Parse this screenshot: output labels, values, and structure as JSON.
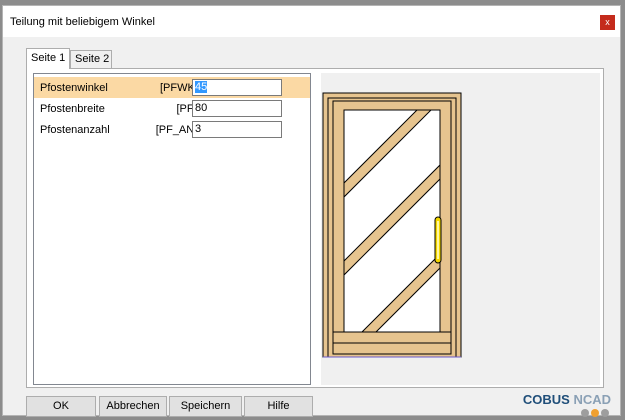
{
  "window": {
    "title": "Teilung mit beliebigem Winkel",
    "close_label": "x"
  },
  "tabs": [
    {
      "label": "Seite 1",
      "active": true
    },
    {
      "label": "Seite 2",
      "active": false
    }
  ],
  "parameters": [
    {
      "label": "Pfostenwinkel",
      "key": "[PFWKL]",
      "value": "45",
      "selected": true
    },
    {
      "label": "Pfostenbreite",
      "key": "[PFB]",
      "value": "80",
      "selected": false
    },
    {
      "label": "Pfostenanzahl",
      "key": "[PF_ANZ]",
      "value": "3",
      "selected": false
    }
  ],
  "buttons": {
    "ok": "OK",
    "cancel": "Abbrechen",
    "save": "Speichern",
    "help": "Hilfe"
  },
  "logo": {
    "part1": "COBUS",
    "part2": " NCAD",
    "dot_colors": [
      "#9e9e9e",
      "#f0a030",
      "#9e9e9e"
    ]
  },
  "colors": {
    "selection_row": "#fbd9a4",
    "door_wood": "#e6c48f",
    "door_outline": "#000000",
    "handle": "#f5d800"
  }
}
